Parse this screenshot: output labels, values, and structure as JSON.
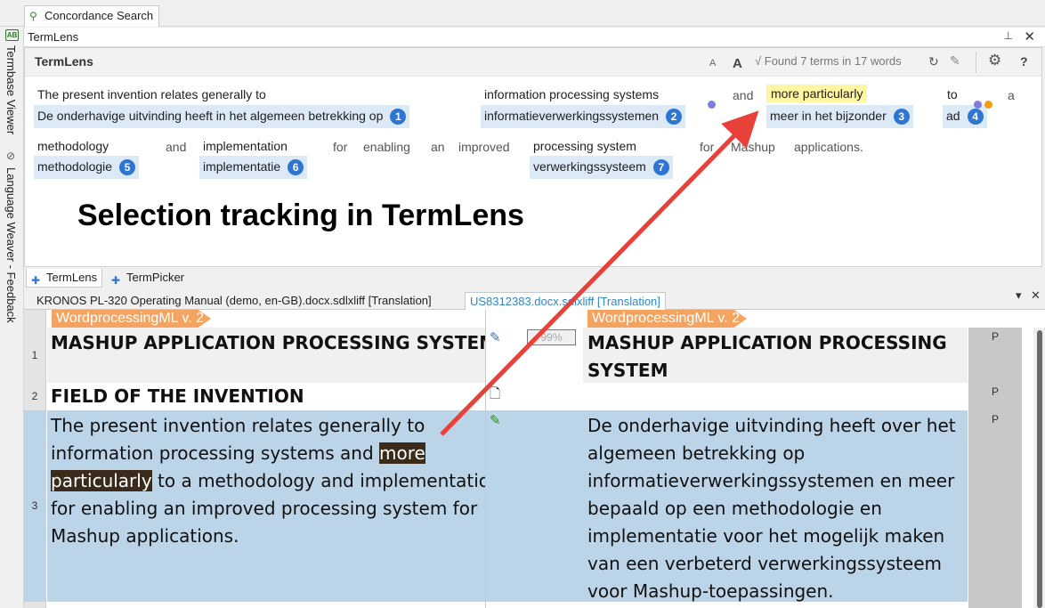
{
  "concordance_tab": {
    "label": "Concordance Search"
  },
  "left_strip": {
    "termbase_viewer": "Termbase Viewer",
    "language_weaver": "Language Weaver - Feedback"
  },
  "termlens_header": {
    "title": "TermLens"
  },
  "termlens_toolbar": {
    "label": "TermLens",
    "font_smaller": "A",
    "font_larger": "A",
    "status": "√ Found 7 terms in 17 words",
    "settings_icon": "gear-icon",
    "help": "?"
  },
  "termlens": {
    "plain_words": [
      "and",
      "to",
      "a",
      "and",
      "for",
      "an",
      "improved",
      "for",
      "applications."
    ],
    "terms": [
      {
        "source": "The present invention relates generally to",
        "target": "De onderhavige uitvinding heeft in het algemeen betrekking op",
        "num": "1"
      },
      {
        "source": "information processing systems",
        "target": "informatieverwerkingssystemen",
        "num": "2"
      },
      {
        "source": "more particularly",
        "target": "meer in het bijzonder",
        "num": "3"
      },
      {
        "source": "to",
        "target": "ad",
        "num": "4"
      },
      {
        "source": "methodology",
        "target": "methodologie",
        "num": "5"
      },
      {
        "source": "implementation",
        "target": "implementatie",
        "num": "6"
      },
      {
        "source": "processing system",
        "target": "verwerkingssysteem",
        "num": "7"
      }
    ],
    "enabling_word": "enabling",
    "mashup_word": "Mashup",
    "caption": "Selection tracking in TermLens"
  },
  "panel_tabs": [
    {
      "label": "TermLens"
    },
    {
      "label": "TermPicker"
    }
  ],
  "doc_tabs": [
    {
      "label": "KRONOS PL-320 Operating Manual (demo, en-GB).docx.sdlxliff [Translation]"
    },
    {
      "label": "US8312383.docx.sdlxliff [Translation]"
    }
  ],
  "doc_controls": {
    "dropdown": "▾",
    "close": "✕"
  },
  "editor": {
    "source_tag": "WordprocessingML v. 2",
    "target_tag": "WordprocessingML v. 2",
    "rows": [
      {
        "num": "1",
        "source": "MASHUP APPLICATION PROCESSING SYSTEM",
        "match": "99%",
        "target": "MASHUP APPLICATION PROCESSING SYSTEM",
        "status": "P"
      },
      {
        "num": "2",
        "source": "FIELD OF THE INVENTION",
        "target": "",
        "status": "P"
      },
      {
        "num": "3",
        "source_before": "The present invention relates generally to information processing systems and ",
        "source_selected": "more particularly",
        "source_after": " to a methodology and implementation for enabling an improved processing system for Mashup applications.",
        "target": "De onderhavige uitvinding heeft over het algemeen betrekking op informatieverwerkingssystemen en meer bepaald op een methodologie en implementatie voor het mogelijk maken van een verbeterd verwerkingssysteem voor Mashup-toepassingen.",
        "status": "P"
      }
    ]
  },
  "colors": {
    "accent": "#2f76d2",
    "term_bg": "#dce9f7",
    "highlight": "#fff6a3",
    "tag": "#f4a460",
    "arrow": "#e8413a",
    "selection": "#3a2b1a"
  }
}
